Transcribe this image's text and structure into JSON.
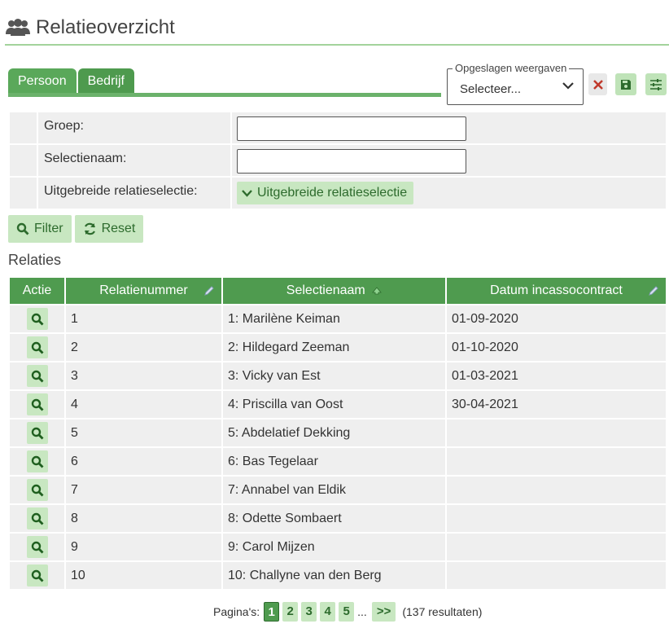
{
  "page": {
    "title": "Relatieoverzicht",
    "icon": "users-icon"
  },
  "tabs": [
    {
      "label": "Persoon",
      "active": true
    },
    {
      "label": "Bedrijf",
      "active": false
    }
  ],
  "saved_views": {
    "legend": "Opgeslagen weergaven",
    "value": "Selecteer..."
  },
  "filter": {
    "group_label": "Groep:",
    "group_value": "",
    "selection_label": "Selectienaam:",
    "selection_value": "",
    "extended_label": "Uitgebreide relatieselectie:",
    "extended_button": "Uitgebreide relatieselectie",
    "filter_button": "Filter",
    "reset_button": "Reset"
  },
  "section_title": "Relaties",
  "table": {
    "headers": [
      "Actie",
      "Relatienummer",
      "Selectienaam",
      "Datum incassocontract"
    ],
    "rows": [
      {
        "nr": "1",
        "name": "1: Marilène Keiman",
        "date": "01-09-2020"
      },
      {
        "nr": "2",
        "name": "2: Hildegard Zeeman",
        "date": "01-10-2020"
      },
      {
        "nr": "3",
        "name": "3: Vicky van Est",
        "date": "01-03-2021"
      },
      {
        "nr": "4",
        "name": "4: Priscilla van Oost",
        "date": "30-04-2021"
      },
      {
        "nr": "5",
        "name": "5: Abdelatief Dekking",
        "date": ""
      },
      {
        "nr": "6",
        "name": "6: Bas Tegelaar",
        "date": ""
      },
      {
        "nr": "7",
        "name": "7: Annabel van Eldik",
        "date": ""
      },
      {
        "nr": "8",
        "name": "8: Odette Sombaert",
        "date": ""
      },
      {
        "nr": "9",
        "name": "9: Carol Mijzen",
        "date": ""
      },
      {
        "nr": "10",
        "name": "10: Challyne van den Berg",
        "date": ""
      }
    ]
  },
  "pagination": {
    "label": "Pagina's:",
    "pages": [
      "1",
      "2",
      "3",
      "4",
      "5"
    ],
    "current": "1",
    "ellipsis": "...",
    "next": ">>",
    "count": "(137 resultaten)"
  },
  "colors": {
    "accent": "#4f9b4f",
    "accent_light": "#c8e7c1",
    "delete": "#c0392b"
  }
}
